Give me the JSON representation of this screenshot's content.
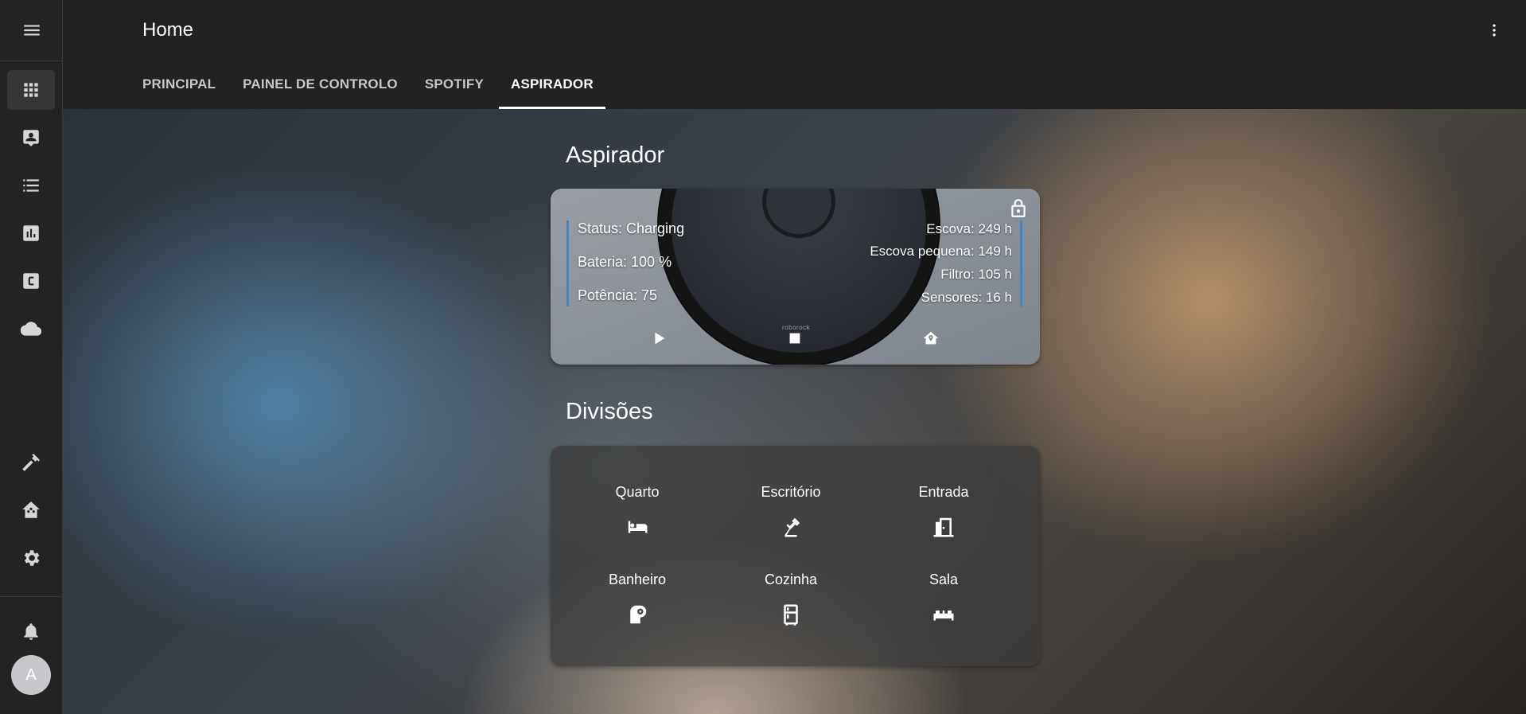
{
  "header": {
    "title": "Home",
    "tabs": [
      {
        "label": "PRINCIPAL"
      },
      {
        "label": "PAINEL DE CONTROLO"
      },
      {
        "label": "SPOTIFY"
      },
      {
        "label": "ASPIRADOR"
      }
    ],
    "active_tab": "ASPIRADOR"
  },
  "sidebar": {
    "items": [
      {
        "icon": "grid-icon",
        "active": true
      },
      {
        "icon": "account-box-icon"
      },
      {
        "icon": "list-icon"
      },
      {
        "icon": "chart-icon"
      },
      {
        "icon": "c-box-icon"
      },
      {
        "icon": "cloud-icon"
      },
      {
        "icon": "hammer-icon"
      },
      {
        "icon": "home-assistant-icon"
      },
      {
        "icon": "gear-icon"
      },
      {
        "icon": "bell-icon"
      }
    ],
    "avatar_initial": "A"
  },
  "vacuum": {
    "section_title": "Aspirador",
    "status": "Status: Charging",
    "battery": "Bateria: 100 %",
    "power": "Potência: 75",
    "brush": "Escova: 249 h",
    "side_brush": "Escova pequena: 149 h",
    "filter": "Filtro: 105 h",
    "sensors": "Sensores: 16 h",
    "brand": "roborock"
  },
  "rooms": {
    "section_title": "Divisões",
    "items": [
      {
        "label": "Quarto",
        "icon": "bed-icon"
      },
      {
        "label": "Escritório",
        "icon": "desk-lamp-icon"
      },
      {
        "label": "Entrada",
        "icon": "door-icon"
      },
      {
        "label": "Banheiro",
        "icon": "toilet-paper-icon"
      },
      {
        "label": "Cozinha",
        "icon": "fridge-icon"
      },
      {
        "label": "Sala",
        "icon": "sofa-icon"
      }
    ]
  },
  "colors": {
    "accent_bar": "#3f86c0",
    "header_bg": "#222222",
    "sidebar_bg": "#232323"
  }
}
